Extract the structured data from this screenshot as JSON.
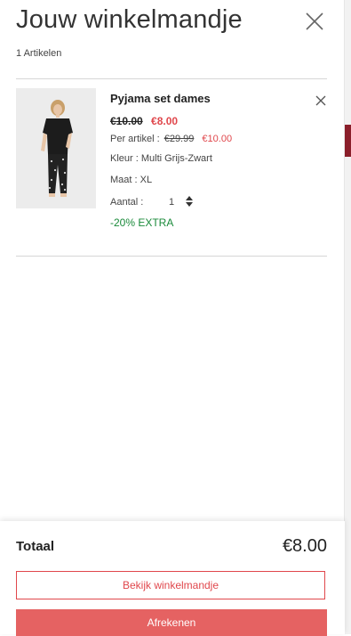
{
  "cart": {
    "title": "Jouw winkelmandje",
    "item_count": "1 Artikelen"
  },
  "item": {
    "name": "Pyjama set dames",
    "old_price": "€10.00",
    "new_price": "€8.00",
    "unit_label": "Per artikel :",
    "unit_old_price": "€29.99",
    "unit_new_price": "€10.00",
    "color": "Kleur : Multi Grijs-Zwart",
    "size": "Maat : XL",
    "quantity_label": "Aantal :",
    "quantity": "1",
    "promo": "-20% EXTRA"
  },
  "footer": {
    "total_label": "Totaal",
    "total_value": "€8.00",
    "view_cart_label": "Bekijk winkelmandje",
    "checkout_label": "Afrekenen"
  },
  "colors": {
    "accent": "#e0474c",
    "checkout_bg": "#e56262",
    "promo_green": "#1a8a3a",
    "edge_accent": "#8b1f2b"
  },
  "icons": [
    "close-icon",
    "remove-item-icon",
    "quantity-stepper-icon"
  ]
}
